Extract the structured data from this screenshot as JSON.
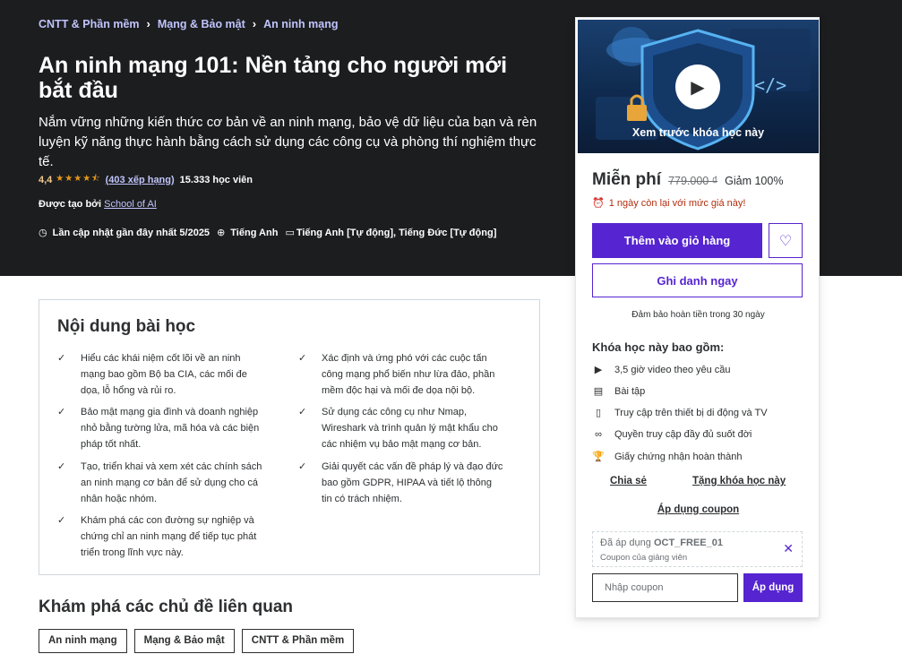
{
  "breadcrumb": [
    "CNTT & Phần mềm",
    "Mạng & Bảo mật",
    "An ninh mạng"
  ],
  "title": "An ninh mạng 101: Nền tảng cho người mới bắt đầu",
  "subtitle": "Nắm vững những kiến thức cơ bản về an ninh mạng, bảo vệ dữ liệu của bạn và rèn luyện kỹ năng thực hành bằng cách sử dụng các công cụ và phòng thí nghiệm thực tế.",
  "rating": {
    "value": "4,4",
    "stars": "★★★★⯪",
    "count_text": "(403 xếp hạng)",
    "students": "15.333 học viên"
  },
  "creator": {
    "label": "Được tạo bởi",
    "name": "School of AI"
  },
  "meta": {
    "updated": "Lần cập nhật gần đây nhất 5/2025",
    "language": "Tiếng Anh",
    "captions": "Tiếng Anh [Tự động], Tiếng Đức [Tự động]"
  },
  "learn": {
    "heading": "Nội dung bài học",
    "left": [
      "Hiểu các khái niệm cốt lõi về an ninh mạng bao gồm Bộ ba CIA, các mối đe dọa, lỗ hổng và rủi ro.",
      "Bảo mật mạng gia đình và doanh nghiệp nhỏ bằng tường lửa, mã hóa và các biện pháp tốt nhất.",
      "Tạo, triển khai và xem xét các chính sách an ninh mạng cơ bản để sử dụng cho cá nhân hoặc nhóm.",
      "Khám phá các con đường sự nghiệp và chứng chỉ an ninh mạng để tiếp tục phát triển trong lĩnh vực này."
    ],
    "right": [
      "Xác định và ứng phó với các cuộc tấn công mạng phổ biến như lừa đảo, phần mềm độc hại và mối đe dọa nội bộ.",
      "Sử dụng các công cụ như Nmap, Wireshark và trình quản lý mật khẩu cho các nhiệm vụ bảo mật mạng cơ bản.",
      "Giải quyết các vấn đề pháp lý và đạo đức bao gồm GDPR, HIPAA và tiết lộ thông tin có trách nhiệm."
    ]
  },
  "related": {
    "heading": "Khám phá các chủ đề liên quan",
    "tags": [
      "An ninh mạng",
      "Mạng & Bảo mật",
      "CNTT & Phần mềm"
    ]
  },
  "sidebar": {
    "preview_label": "Xem trước khóa học này",
    "price": "Miễn phí",
    "original_price": "779.000 ₫",
    "discount": "Giảm 100%",
    "timer": "1 ngày còn lại với mức giá này!",
    "add_to_cart": "Thêm vào giỏ hàng",
    "enroll": "Ghi danh ngay",
    "guarantee": "Đảm bảo hoàn tiền trong 30 ngày",
    "includes_title": "Khóa học này bao gồm:",
    "includes": [
      {
        "icon": "video-icon",
        "glyph": "▶",
        "text": "3,5 giờ video theo yêu cầu"
      },
      {
        "icon": "assignment-icon",
        "glyph": "▤",
        "text": "Bài tập"
      },
      {
        "icon": "mobile-icon",
        "glyph": "▯",
        "text": "Truy cập trên thiết bị di động và TV"
      },
      {
        "icon": "infinity-icon",
        "glyph": "∞",
        "text": "Quyền truy cập đầy đủ suốt đời"
      },
      {
        "icon": "trophy-icon",
        "glyph": "🏆",
        "text": "Giấy chứng nhận hoàn thành"
      }
    ],
    "share": "Chia sẻ",
    "gift": "Tặng khóa học này",
    "apply_coupon_link": "Áp dụng coupon",
    "coupon_applied_label": "Đã áp dụng",
    "coupon_code": "OCT_FREE_01",
    "coupon_note": "Coupon của giảng viên",
    "coupon_placeholder": "Nhập coupon",
    "coupon_button": "Áp dụng"
  },
  "colors": {
    "accent": "#5624d0",
    "hero_bg": "#1c1d1f",
    "link": "#c0c4fc",
    "rating": "#f3ca8c",
    "timer": "#b32d0f"
  }
}
